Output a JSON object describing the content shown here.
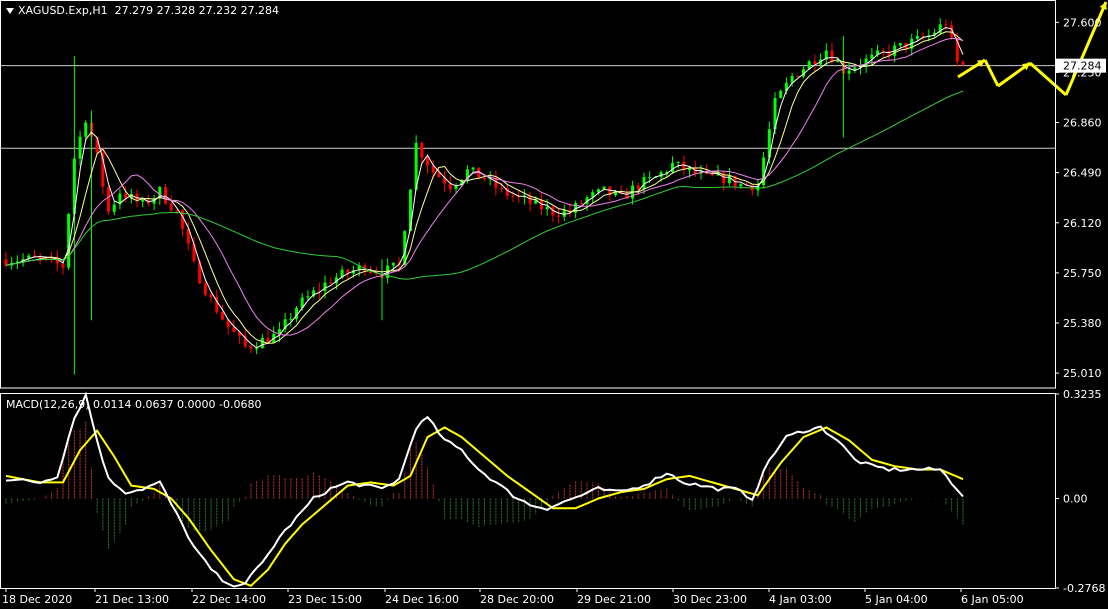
{
  "header": {
    "symbol": "XAGUSD.Exp,H1",
    "ohlc": "27.279 27.328 27.232 27.284"
  },
  "macd_header": "MACD(12,26,9) 0.0114 0.0637 0.0000 -0.0680",
  "colors": {
    "bull": "#00ff00",
    "bear": "#ff0000",
    "ma_fast": "#ffffff",
    "ma_mid": "#ffff99",
    "ma_slow": "#ee82ee",
    "ma_long": "#33cc33",
    "signal": "#ffff00",
    "macd": "#ffffff",
    "hist_pos": "#cc3333",
    "hist_neg": "#2e7d32",
    "arrow": "#ffff00",
    "grid": "#cccccc"
  },
  "chart_data": [
    {
      "type": "candlestick",
      "ylim": [
        24.9,
        27.75
      ],
      "y_ticks": [
        "27.600",
        "27.230",
        "26.860",
        "26.490",
        "26.120",
        "25.750",
        "25.380",
        "25.010"
      ],
      "y_tick_values": [
        27.6,
        27.23,
        26.86,
        26.49,
        26.12,
        25.75,
        25.38,
        25.01
      ],
      "current_price": "27.284",
      "horizontal_lines": [
        27.28,
        26.67
      ],
      "x_ticks": [
        "18 Dec 2020",
        "21 Dec 13:00",
        "22 Dec 14:00",
        "23 Dec 15:00",
        "24 Dec 16:00",
        "28 Dec 20:00",
        "29 Dec 21:00",
        "30 Dec 23:00",
        "4 Jan 03:00",
        "5 Jan 04:00",
        "6 Jan 05:00"
      ],
      "close_path": [
        [
          0,
          25.85
        ],
        [
          6,
          25.85
        ],
        [
          10,
          25.8
        ],
        [
          12,
          26.6
        ],
        [
          14,
          26.9
        ],
        [
          16,
          26.6
        ],
        [
          18,
          26.2
        ],
        [
          20,
          26.35
        ],
        [
          24,
          26.25
        ],
        [
          27,
          26.35
        ],
        [
          30,
          26.2
        ],
        [
          33,
          25.8
        ],
        [
          36,
          25.55
        ],
        [
          39,
          25.35
        ],
        [
          42,
          25.2
        ],
        [
          45,
          25.25
        ],
        [
          48,
          25.3
        ],
        [
          51,
          25.5
        ],
        [
          54,
          25.6
        ],
        [
          57,
          25.7
        ],
        [
          60,
          25.75
        ],
        [
          63,
          25.8
        ],
        [
          66,
          25.75
        ],
        [
          69,
          25.8
        ],
        [
          72,
          26.7
        ],
        [
          75,
          26.5
        ],
        [
          78,
          26.4
        ],
        [
          81,
          26.5
        ],
        [
          84,
          26.45
        ],
        [
          87,
          26.35
        ],
        [
          90,
          26.3
        ],
        [
          93,
          26.25
        ],
        [
          96,
          26.2
        ],
        [
          99,
          26.2
        ],
        [
          102,
          26.3
        ],
        [
          105,
          26.35
        ],
        [
          108,
          26.3
        ],
        [
          111,
          26.4
        ],
        [
          114,
          26.45
        ],
        [
          117,
          26.55
        ],
        [
          120,
          26.5
        ],
        [
          123,
          26.45
        ],
        [
          126,
          26.45
        ],
        [
          129,
          26.4
        ],
        [
          132,
          26.4
        ],
        [
          135,
          27.0
        ],
        [
          138,
          27.2
        ],
        [
          141,
          27.3
        ],
        [
          144,
          27.4
        ],
        [
          147,
          27.25
        ],
        [
          150,
          27.3
        ],
        [
          153,
          27.35
        ],
        [
          156,
          27.4
        ],
        [
          159,
          27.45
        ],
        [
          162,
          27.5
        ],
        [
          165,
          27.6
        ],
        [
          167,
          27.3
        ],
        [
          168,
          27.28
        ]
      ],
      "spikes": [
        [
          12,
          27.35,
          25.0
        ],
        [
          15,
          26.95,
          25.4
        ],
        [
          66,
          25.85,
          25.4
        ],
        [
          147,
          27.5,
          26.75
        ]
      ],
      "forecast_arrows": [
        [
          [
            958,
            77
          ],
          [
            985,
            60
          ]
        ],
        [
          [
            985,
            60
          ],
          [
            998,
            86
          ]
        ],
        [
          [
            998,
            86
          ],
          [
            1030,
            63
          ]
        ],
        [
          [
            1030,
            63
          ],
          [
            1066,
            95
          ]
        ],
        [
          [
            1066,
            95
          ],
          [
            1106,
            2
          ]
        ]
      ]
    },
    {
      "type": "macd",
      "ylim": [
        -0.2768,
        0.3235
      ],
      "y_ticks": [
        "0.3235",
        "0.00",
        "-0.2768"
      ],
      "y_tick_values": [
        0.3235,
        0.0,
        -0.2768
      ],
      "macd_path": [
        [
          0,
          0.06
        ],
        [
          6,
          0.05
        ],
        [
          9,
          0.07
        ],
        [
          12,
          0.25
        ],
        [
          14,
          0.32
        ],
        [
          16,
          0.18
        ],
        [
          18,
          0.06
        ],
        [
          21,
          0.02
        ],
        [
          24,
          0.03
        ],
        [
          27,
          0.05
        ],
        [
          30,
          -0.05
        ],
        [
          33,
          -0.15
        ],
        [
          36,
          -0.22
        ],
        [
          39,
          -0.27
        ],
        [
          42,
          -0.26
        ],
        [
          45,
          -0.2
        ],
        [
          48,
          -0.12
        ],
        [
          51,
          -0.06
        ],
        [
          54,
          -0.0
        ],
        [
          57,
          0.03
        ],
        [
          60,
          0.05
        ],
        [
          63,
          0.04
        ],
        [
          66,
          0.03
        ],
        [
          69,
          0.06
        ],
        [
          72,
          0.22
        ],
        [
          74,
          0.25
        ],
        [
          77,
          0.18
        ],
        [
          80,
          0.15
        ],
        [
          83,
          0.09
        ],
        [
          86,
          0.05
        ],
        [
          89,
          0.01
        ],
        [
          92,
          -0.02
        ],
        [
          95,
          -0.03
        ],
        [
          98,
          -0.01
        ],
        [
          101,
          0.01
        ],
        [
          104,
          0.03
        ],
        [
          107,
          0.02
        ],
        [
          110,
          0.03
        ],
        [
          113,
          0.05
        ],
        [
          116,
          0.08
        ],
        [
          119,
          0.05
        ],
        [
          122,
          0.04
        ],
        [
          125,
          0.03
        ],
        [
          128,
          0.03
        ],
        [
          131,
          0.0
        ],
        [
          134,
          0.12
        ],
        [
          137,
          0.19
        ],
        [
          140,
          0.21
        ],
        [
          143,
          0.22
        ],
        [
          146,
          0.18
        ],
        [
          149,
          0.12
        ],
        [
          152,
          0.1
        ],
        [
          155,
          0.09
        ],
        [
          158,
          0.09
        ],
        [
          161,
          0.09
        ],
        [
          164,
          0.09
        ],
        [
          167,
          0.03
        ],
        [
          168,
          0.01
        ]
      ],
      "signal_path": [
        [
          0,
          0.07
        ],
        [
          6,
          0.05
        ],
        [
          10,
          0.05
        ],
        [
          13,
          0.15
        ],
        [
          16,
          0.21
        ],
        [
          19,
          0.13
        ],
        [
          22,
          0.04
        ],
        [
          26,
          0.03
        ],
        [
          29,
          0.0
        ],
        [
          32,
          -0.06
        ],
        [
          36,
          -0.16
        ],
        [
          40,
          -0.25
        ],
        [
          43,
          -0.27
        ],
        [
          46,
          -0.22
        ],
        [
          49,
          -0.14
        ],
        [
          52,
          -0.08
        ],
        [
          56,
          -0.02
        ],
        [
          60,
          0.04
        ],
        [
          64,
          0.05
        ],
        [
          68,
          0.04
        ],
        [
          71,
          0.07
        ],
        [
          74,
          0.19
        ],
        [
          77,
          0.22
        ],
        [
          80,
          0.19
        ],
        [
          84,
          0.13
        ],
        [
          88,
          0.07
        ],
        [
          92,
          0.02
        ],
        [
          96,
          -0.03
        ],
        [
          100,
          -0.03
        ],
        [
          104,
          0.0
        ],
        [
          108,
          0.02
        ],
        [
          112,
          0.03
        ],
        [
          116,
          0.06
        ],
        [
          120,
          0.07
        ],
        [
          124,
          0.05
        ],
        [
          128,
          0.03
        ],
        [
          132,
          0.01
        ],
        [
          136,
          0.11
        ],
        [
          140,
          0.19
        ],
        [
          144,
          0.22
        ],
        [
          148,
          0.18
        ],
        [
          152,
          0.12
        ],
        [
          156,
          0.1
        ],
        [
          160,
          0.09
        ],
        [
          164,
          0.09
        ],
        [
          168,
          0.06
        ]
      ]
    }
  ]
}
